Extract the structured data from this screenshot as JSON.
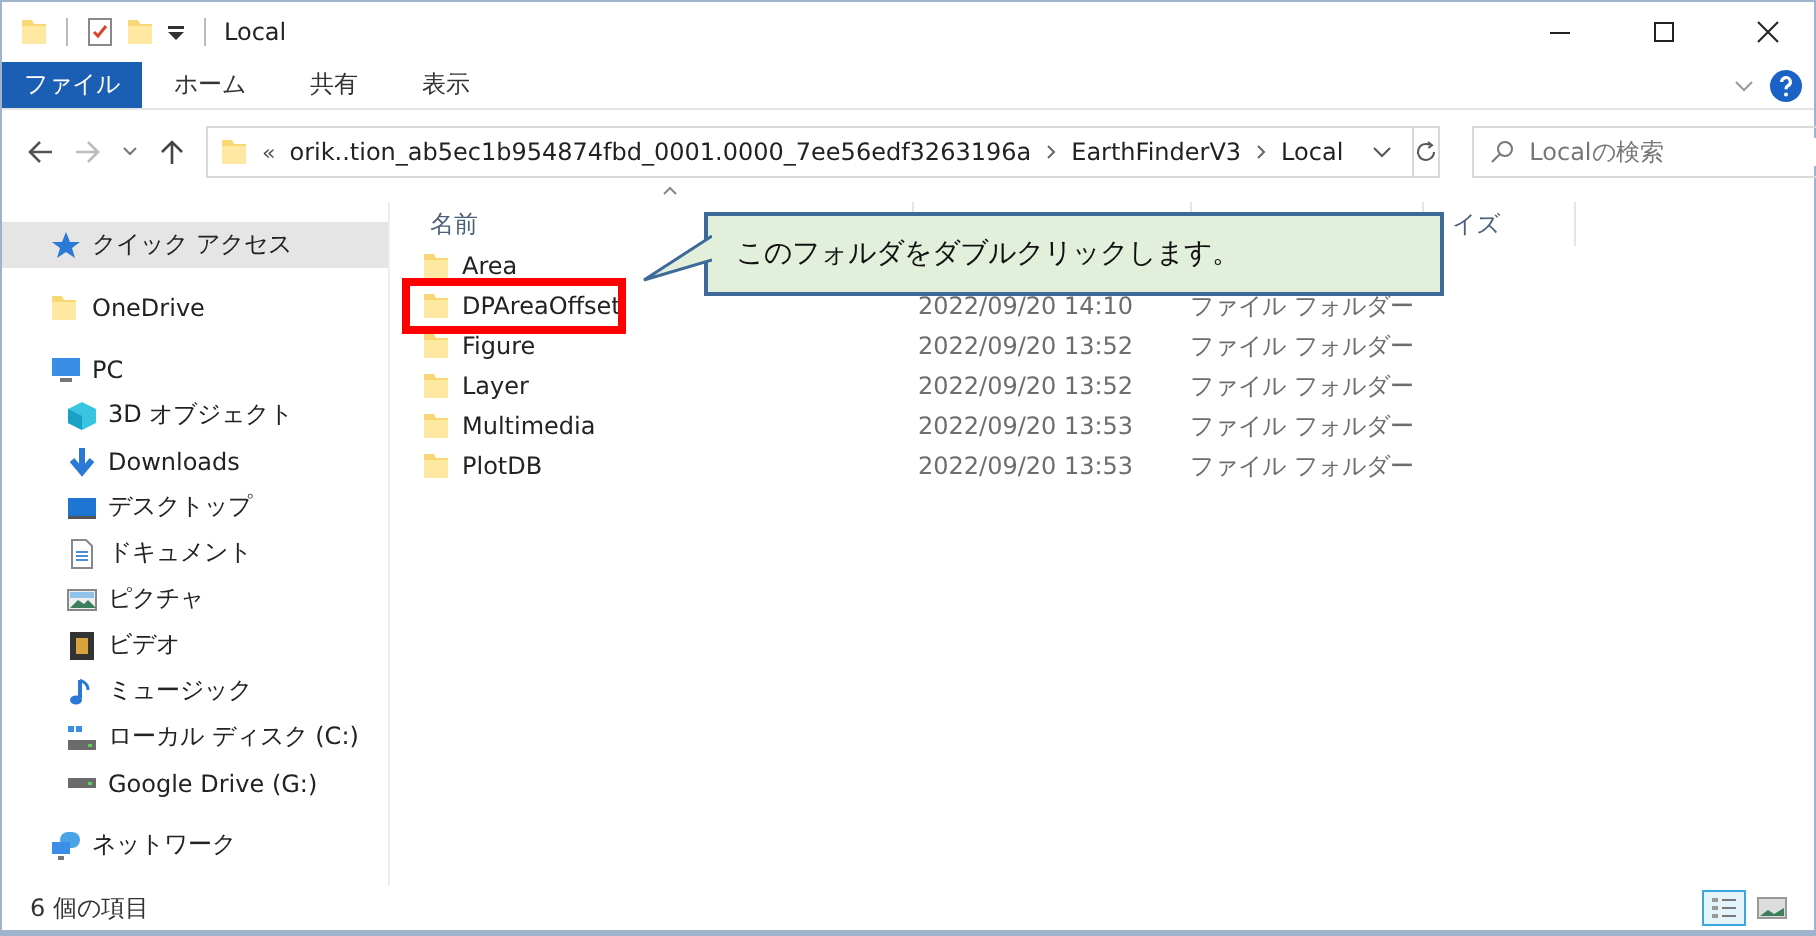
{
  "window": {
    "title": "Local"
  },
  "ribbon_tabs": [
    {
      "label": "ファイル",
      "selected": true
    },
    {
      "label": "ホーム",
      "selected": false
    },
    {
      "label": "共有",
      "selected": false
    },
    {
      "label": "表示",
      "selected": false
    }
  ],
  "address_bar": {
    "prefix": "«",
    "segments": [
      "orik..tion_ab5ec1b954874fbd_0001.0000_7ee56edf3263196a",
      "EarthFinderV3",
      "Local"
    ]
  },
  "search": {
    "placeholder": "Localの検索"
  },
  "sidebar": {
    "items": [
      {
        "label": "クイック アクセス",
        "kind": "quick",
        "selected": true
      },
      {
        "label": "OneDrive",
        "kind": "folder",
        "selected": false
      },
      {
        "label": "PC",
        "kind": "pc",
        "selected": false,
        "children": [
          {
            "label": "3D オブジェクト",
            "kind": "cube",
            "selected": false
          },
          {
            "label": "Downloads",
            "kind": "download",
            "selected": false
          },
          {
            "label": "デスクトップ",
            "kind": "desktop",
            "selected": false
          },
          {
            "label": "ドキュメント",
            "kind": "document",
            "selected": false
          },
          {
            "label": "ピクチャ",
            "kind": "pictures",
            "selected": false
          },
          {
            "label": "ビデオ",
            "kind": "video",
            "selected": false
          },
          {
            "label": "ミュージック",
            "kind": "music",
            "selected": false
          },
          {
            "label": "ローカル ディスク (C:)",
            "kind": "disk",
            "selected": false
          },
          {
            "label": "Google Drive (G:)",
            "kind": "drive",
            "selected": false
          }
        ]
      },
      {
        "label": "ネットワーク",
        "kind": "network",
        "selected": false
      }
    ]
  },
  "file_list": {
    "columns": [
      "名前",
      "イズ"
    ],
    "rows": [
      {
        "name": "Area",
        "marked": false
      },
      {
        "name": "DPAreaOffset",
        "date": "2022/09/20 14:10",
        "type": "ファイル フォルダー",
        "marked": true
      },
      {
        "name": "Figure",
        "date": "2022/09/20 13:52",
        "type": "ファイル フォルダー",
        "marked": false
      },
      {
        "name": "Layer",
        "date": "2022/09/20 13:52",
        "type": "ファイル フォルダー",
        "marked": false
      },
      {
        "name": "Multimedia",
        "date": "2022/09/20 13:53",
        "type": "ファイル フォルダー",
        "marked": false
      },
      {
        "name": "PlotDB",
        "date": "2022/09/20 13:53",
        "type": "ファイル フォルダー",
        "marked": false
      }
    ]
  },
  "callout": {
    "text": "このフォルダをダブルクリックします。"
  },
  "status_bar": {
    "text": "6 個の項目",
    "view_buttons": [
      {
        "kind": "details",
        "selected": true
      },
      {
        "kind": "thumbnails",
        "selected": false
      }
    ]
  }
}
